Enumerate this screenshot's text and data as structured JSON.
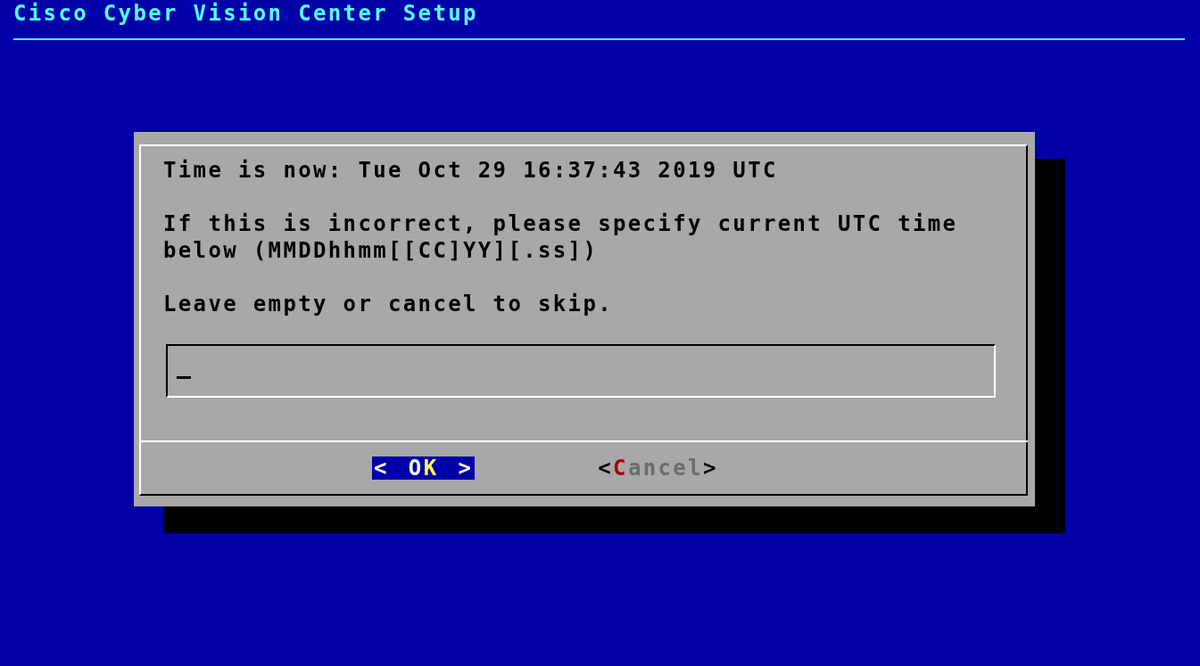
{
  "screen": {
    "title": "Cisco Cyber Vision Center Setup"
  },
  "dialog": {
    "lines": [
      {
        "text": "Time is now: Tue Oct 29 16:37:43 2019 UTC"
      },
      {
        "text": "If this is incorrect, please specify current UTC time\nbelow (MMDDhhmm[[CC]YY][.ss])"
      },
      {
        "text": "Leave empty or cancel to skip."
      }
    ],
    "input": {
      "focused": true
    },
    "buttons": [
      {
        "left": "<",
        "before": "O",
        "hotkey": "K",
        "right": ">",
        "selected": true
      },
      {
        "left": "<",
        "hotkey": "C",
        "after": "ancel",
        "right": ">",
        "selected": false
      }
    ]
  }
}
